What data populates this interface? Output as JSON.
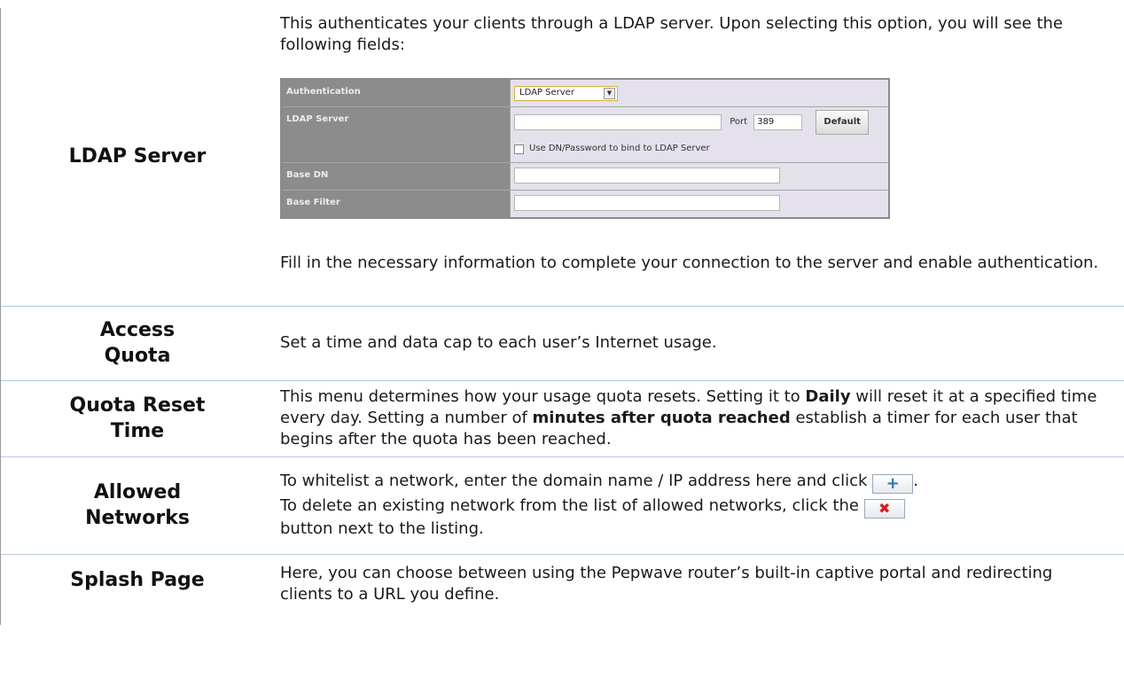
{
  "rows": {
    "ldap": {
      "term": "LDAP Server",
      "intro": "This authenticates your clients through a LDAP server. Upon selecting this option, you will see the following fields:",
      "panel": {
        "auth_label": "Authentication",
        "auth_value": "LDAP Server",
        "server_label": "LDAP Server",
        "port_label": "Port",
        "port_value": "389",
        "default_button": "Default",
        "bind_checkbox_label": "Use DN/Password to bind to LDAP Server",
        "base_dn_label": "Base DN",
        "base_filter_label": "Base Filter"
      },
      "outro": "Fill in the necessary information to complete your connection to the server and enable authentication."
    },
    "quota": {
      "term_1": "Access",
      "term_2": "Quota",
      "desc": "Set a time and data cap to each user’s Internet usage."
    },
    "reset": {
      "term_1": "Quota Reset",
      "term_2": "Time",
      "desc_1": "This menu determines how your usage quota resets. Setting it to ",
      "bold_1": "Daily",
      "desc_2": " will reset it at a specified time every day. Setting a number of ",
      "bold_2": "minutes after quota reached",
      "desc_3": " establish a timer for each user that begins after the quota has been reached."
    },
    "networks": {
      "term_1": "Allowed",
      "term_2": "Networks",
      "desc_1": "To whitelist a network, enter the domain name / IP address here and click ",
      "desc_2": ".",
      "desc_3": "To delete an existing network from the list of allowed networks, click the ",
      "desc_4": "button next to the listing.",
      "add_icon": "plus-icon",
      "delete_icon": "close-icon"
    },
    "splash": {
      "term": "Splash Page",
      "desc": "Here, you can choose between using the Pepwave router’s built-in captive portal and redirecting clients to a URL you define."
    }
  },
  "colors": {
    "row_separator": "#b9c9de",
    "panel_label_bg": "#8c8c8c",
    "panel_value_bg": "#e4e1ec",
    "add_icon_color": "#1f73c9",
    "delete_icon_color": "#d61d1d"
  }
}
